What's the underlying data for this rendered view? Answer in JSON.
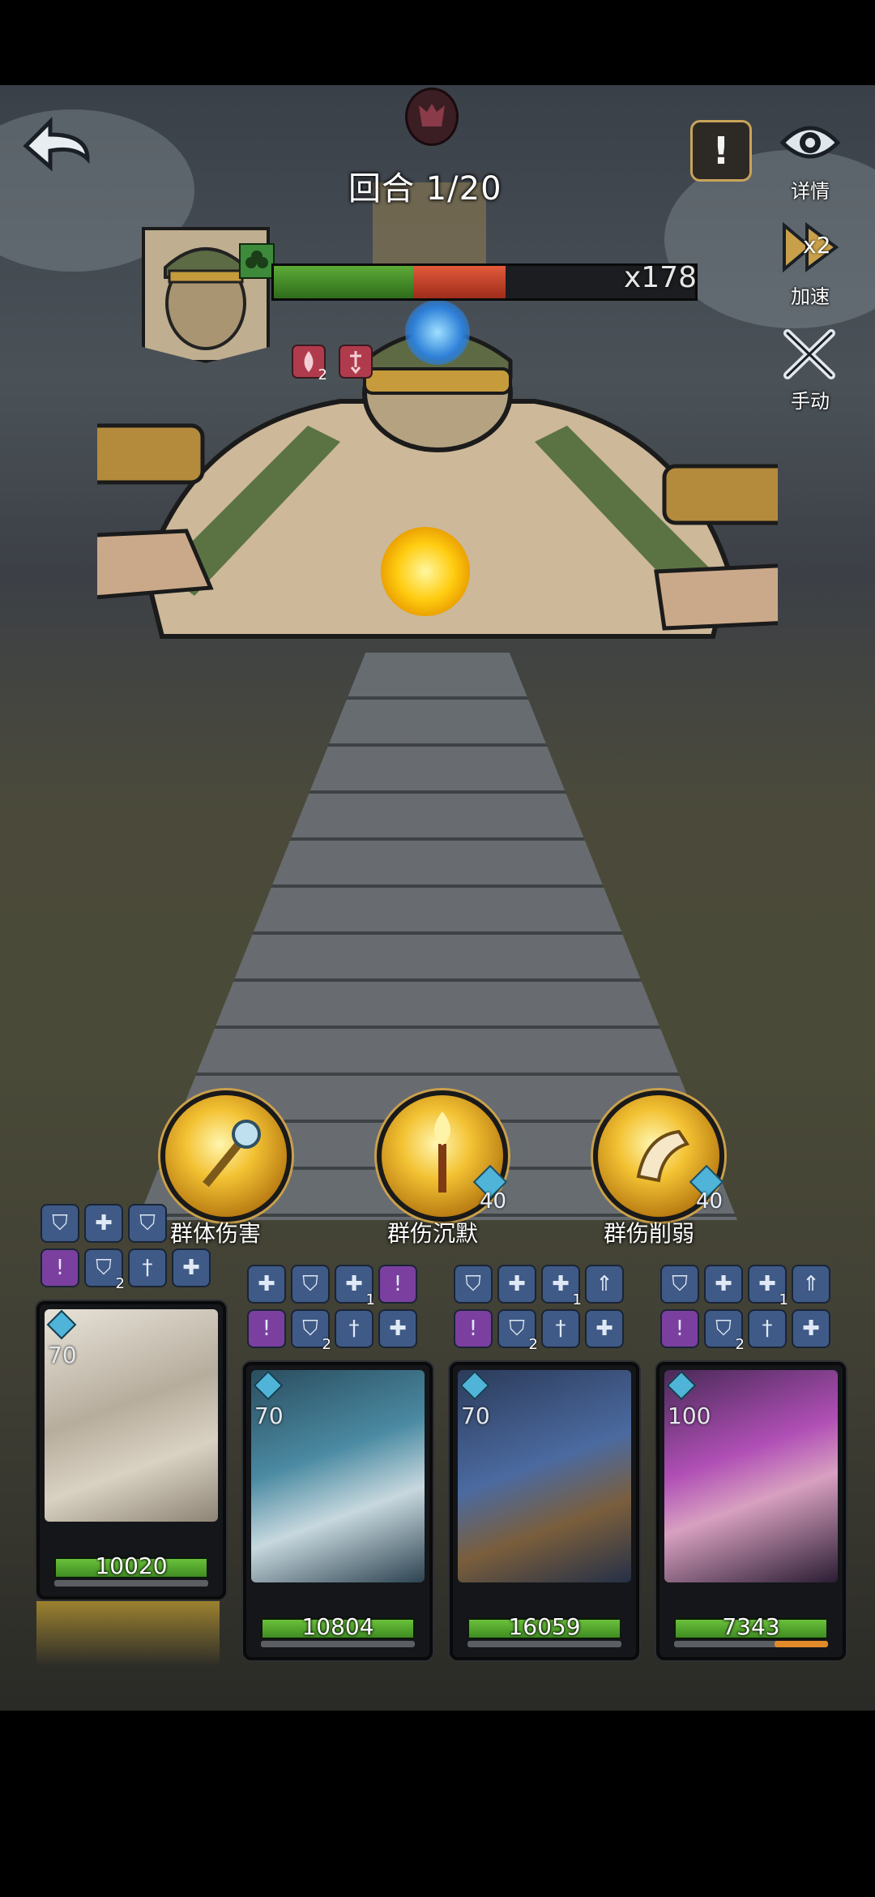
{
  "round": {
    "label": "回合 1/20"
  },
  "boss": {
    "hp_multiplier": "x178",
    "hp_fraction": 0.55,
    "buffs": [
      {
        "icon": "blood-drop-icon",
        "count": "2"
      },
      {
        "icon": "sword-down-icon",
        "count": ""
      }
    ]
  },
  "side_buttons": [
    {
      "id": "details",
      "icon": "eye-icon",
      "label": "详情"
    },
    {
      "id": "speed",
      "icon": "fast-forward-icon",
      "badge": "x2",
      "label": "加速"
    },
    {
      "id": "manual",
      "icon": "crossed-swords-icon",
      "label": "手动"
    }
  ],
  "skills": [
    {
      "label": "群体伤害",
      "cost": ""
    },
    {
      "label": "群伤沉默",
      "cost": "40"
    },
    {
      "label": "群伤削弱",
      "cost": "40"
    }
  ],
  "heroes": [
    {
      "level": "70",
      "hp": "10020",
      "energy": 0.0,
      "status_row1": [
        {
          "t": "shield",
          "n": ""
        },
        {
          "t": "shield-plus",
          "n": ""
        },
        {
          "t": "shield",
          "n": ""
        }
      ],
      "status_row2": [
        {
          "t": "alert",
          "n": ""
        },
        {
          "t": "shield",
          "n": "2"
        },
        {
          "t": "sword",
          "n": ""
        },
        {
          "t": "shield-plus",
          "n": ""
        }
      ]
    },
    {
      "level": "70",
      "hp": "10804",
      "energy": 0.0,
      "status_row1": [
        {
          "t": "shield-plus",
          "n": ""
        },
        {
          "t": "shield",
          "n": ""
        },
        {
          "t": "shield-plus",
          "n": "1"
        },
        {
          "t": "alert",
          "n": ""
        }
      ],
      "status_row2": [
        {
          "t": "alert",
          "n": ""
        },
        {
          "t": "shield",
          "n": "2"
        },
        {
          "t": "sword",
          "n": ""
        },
        {
          "t": "shield-plus",
          "n": ""
        }
      ]
    },
    {
      "level": "70",
      "hp": "16059",
      "energy": 0.0,
      "status_row1": [
        {
          "t": "shield",
          "n": ""
        },
        {
          "t": "shield-plus",
          "n": ""
        },
        {
          "t": "shield-plus",
          "n": "1"
        },
        {
          "t": "up",
          "n": ""
        }
      ],
      "status_row2": [
        {
          "t": "alert",
          "n": ""
        },
        {
          "t": "shield",
          "n": "2"
        },
        {
          "t": "sword",
          "n": ""
        },
        {
          "t": "shield-plus",
          "n": ""
        }
      ]
    },
    {
      "level": "100",
      "hp": "7343",
      "energy": 0.35,
      "status_row1": [
        {
          "t": "shield",
          "n": ""
        },
        {
          "t": "shield-plus",
          "n": ""
        },
        {
          "t": "shield-plus",
          "n": "1"
        },
        {
          "t": "up",
          "n": ""
        }
      ],
      "status_row2": [
        {
          "t": "alert",
          "n": ""
        },
        {
          "t": "shield",
          "n": "2"
        },
        {
          "t": "sword",
          "n": ""
        },
        {
          "t": "shield-plus",
          "n": ""
        }
      ]
    }
  ],
  "colors": {
    "hp_green": "#4f9e2c",
    "boss_red": "#c0392b",
    "gold": "#f3c233",
    "status_blue": "#3f5a86",
    "status_purple": "#7b3f9f"
  }
}
